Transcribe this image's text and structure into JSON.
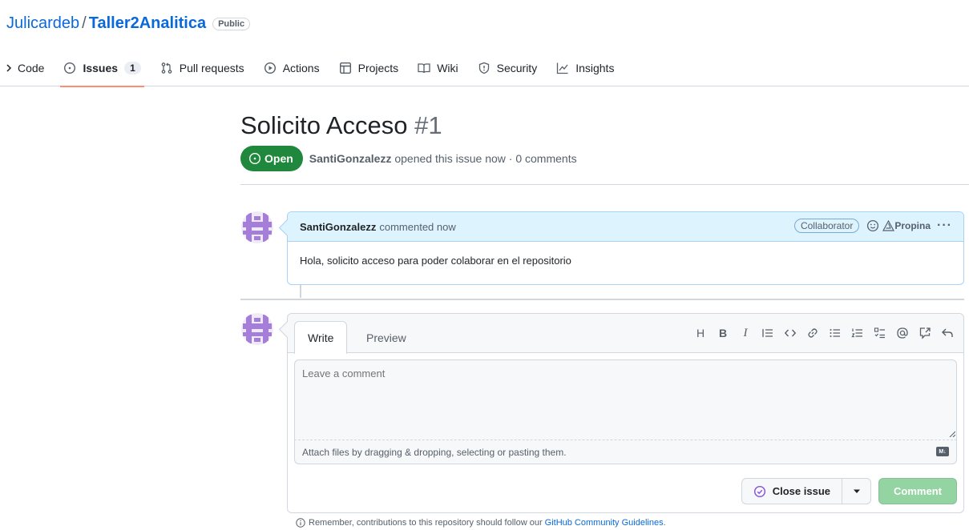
{
  "repo": {
    "owner": "Julicardeb",
    "separator": "/",
    "name": "Taller2Analitica",
    "visibility": "Public"
  },
  "tabs": [
    {
      "label": "Code",
      "icon": "chevron-right-icon"
    },
    {
      "label": "Issues",
      "icon": "issue-opened-icon",
      "count": "1",
      "active": true
    },
    {
      "label": "Pull requests",
      "icon": "git-pull-request-icon"
    },
    {
      "label": "Actions",
      "icon": "play-icon"
    },
    {
      "label": "Projects",
      "icon": "table-icon"
    },
    {
      "label": "Wiki",
      "icon": "book-icon"
    },
    {
      "label": "Security",
      "icon": "shield-icon"
    },
    {
      "label": "Insights",
      "icon": "graph-icon"
    }
  ],
  "issue": {
    "title": "Solicito Acceso",
    "number": "#1",
    "state": "Open",
    "author": "SantiGonzalezz",
    "meta": "opened this issue now · 0 comments"
  },
  "comment": {
    "author": "SantiGonzalezz",
    "when": "commented now",
    "role": "Collaborator",
    "tip_label": "Propina",
    "more": "···",
    "body": "Hola, solicito acceso para poder colaborar en el repositorio"
  },
  "editor": {
    "write_tab": "Write",
    "preview_tab": "Preview",
    "placeholder": "Leave a comment",
    "attach_text": "Attach files by dragging & dropping, selecting or pasting them.",
    "markdown_badge": "M↓",
    "toolbar": {
      "heading": "H",
      "bold": "B",
      "italic": "I"
    },
    "close_label": "Close issue",
    "comment_label": "Comment"
  },
  "footer": {
    "text": "Remember, contributions to this repository should follow our",
    "link": "GitHub Community Guidelines",
    "end": "."
  },
  "colors": {
    "accent_link": "#0969da",
    "open_green": "#1f883d",
    "comment_disabled": "#94d3a2",
    "tab_underline": "#fd8c73",
    "avatar_purple": "#a47ed8"
  }
}
